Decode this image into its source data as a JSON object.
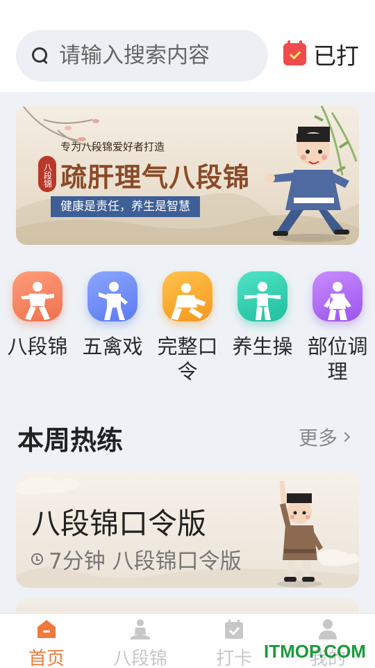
{
  "search": {
    "placeholder": "请输入搜索内容",
    "icon": "search-icon"
  },
  "checkin": {
    "label": "已打",
    "icon": "calendar-check-icon",
    "icon_color": "#ef4b4b"
  },
  "banner": {
    "tagline": "专为八段锦爱好者打造",
    "seal": "八段锦",
    "title": "疏肝理气八段锦",
    "subtitle": "健康是责任，养生是智慧"
  },
  "categories": [
    {
      "label": "八段锦",
      "icon": "baduanjin-figure-icon",
      "color": "#f5845f"
    },
    {
      "label": "五禽戏",
      "icon": "wuqinxi-figure-icon",
      "color": "#6f8ff5"
    },
    {
      "label": "完整口令",
      "icon": "command-figure-icon",
      "color": "#f8a72f"
    },
    {
      "label": "养生操",
      "icon": "exercise-figure-icon",
      "color": "#2fcdb0"
    },
    {
      "label": "部位调理",
      "icon": "body-care-figure-icon",
      "color": "#b06af0"
    }
  ],
  "section": {
    "title": "本周热练",
    "more": "更多"
  },
  "workouts": [
    {
      "title": "八段锦口令版",
      "meta": "7分钟 八段锦口令版"
    }
  ],
  "tabs": [
    {
      "label": "首页",
      "icon": "home-icon",
      "active": true
    },
    {
      "label": "八段锦",
      "icon": "meditation-icon",
      "active": false
    },
    {
      "label": "打卡",
      "icon": "calendar-check-icon",
      "active": false
    },
    {
      "label": "我的",
      "icon": "person-icon",
      "active": false
    }
  ],
  "watermark": "ITMOP.COM",
  "colors": {
    "accent": "#f07a3c",
    "inactive": "#c7c7c7"
  }
}
